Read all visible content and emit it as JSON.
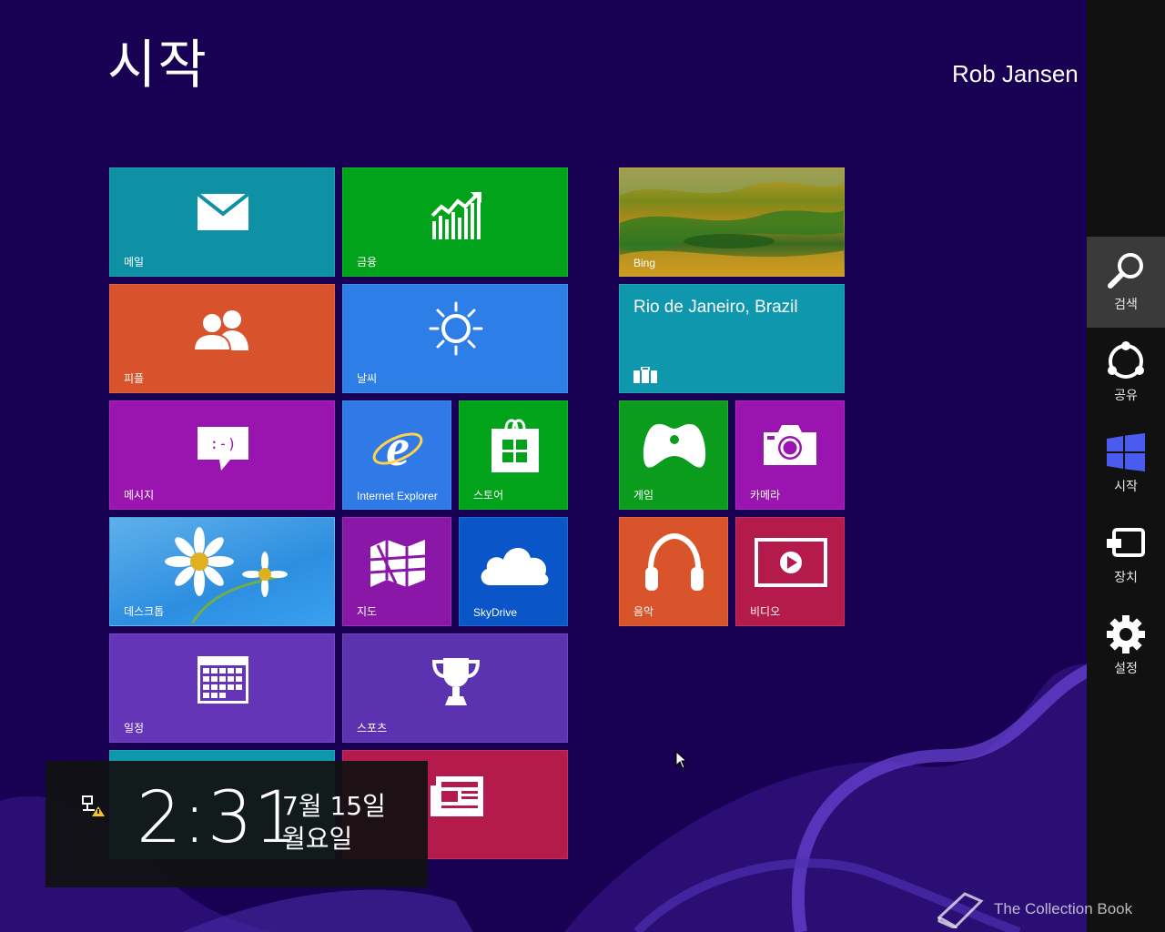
{
  "screen": {
    "title": "시작",
    "user": "Rob Jansen"
  },
  "tiles": {
    "mail": "메일",
    "finance": "금융",
    "bing": "Bing",
    "travel": "Rio de Janeiro, Brazil",
    "people": "피플",
    "weather": "날씨",
    "messaging": "메시지",
    "ie": "Internet Explorer",
    "store": "스토어",
    "games": "게임",
    "camera": "카메라",
    "desktop": "데스크톱",
    "maps": "지도",
    "skydrive": "SkyDrive",
    "music": "음악",
    "video": "비디오",
    "calendar": "일정",
    "sports": "스포츠"
  },
  "charms": {
    "search": "검색",
    "share": "공유",
    "start": "시작",
    "devices": "장치",
    "settings": "설정"
  },
  "clock": {
    "time": "2:31",
    "date": "7월 15일",
    "weekday": "월요일"
  },
  "watermark": "The Collection Book",
  "colors": {
    "background": "#180052",
    "mail": "#0e91a5",
    "finance": "#00a319",
    "people": "#d8532b",
    "weather": "#2d7ee6",
    "messaging": "#9a14b0",
    "ie": "#2f7ae6",
    "store": "#00a319",
    "games": "#0c9c1d",
    "camera": "#9a14b0",
    "maps": "#8a17a8",
    "skydrive": "#0a56c8",
    "music": "#d9542b",
    "video": "#b51a4c",
    "calendar": "#6535b8",
    "sports": "#5b33b0",
    "travel": "#0e97ad",
    "news": "#b51a4c",
    "charms": "#111111",
    "start_charm_logo": "#4a5cf0"
  }
}
